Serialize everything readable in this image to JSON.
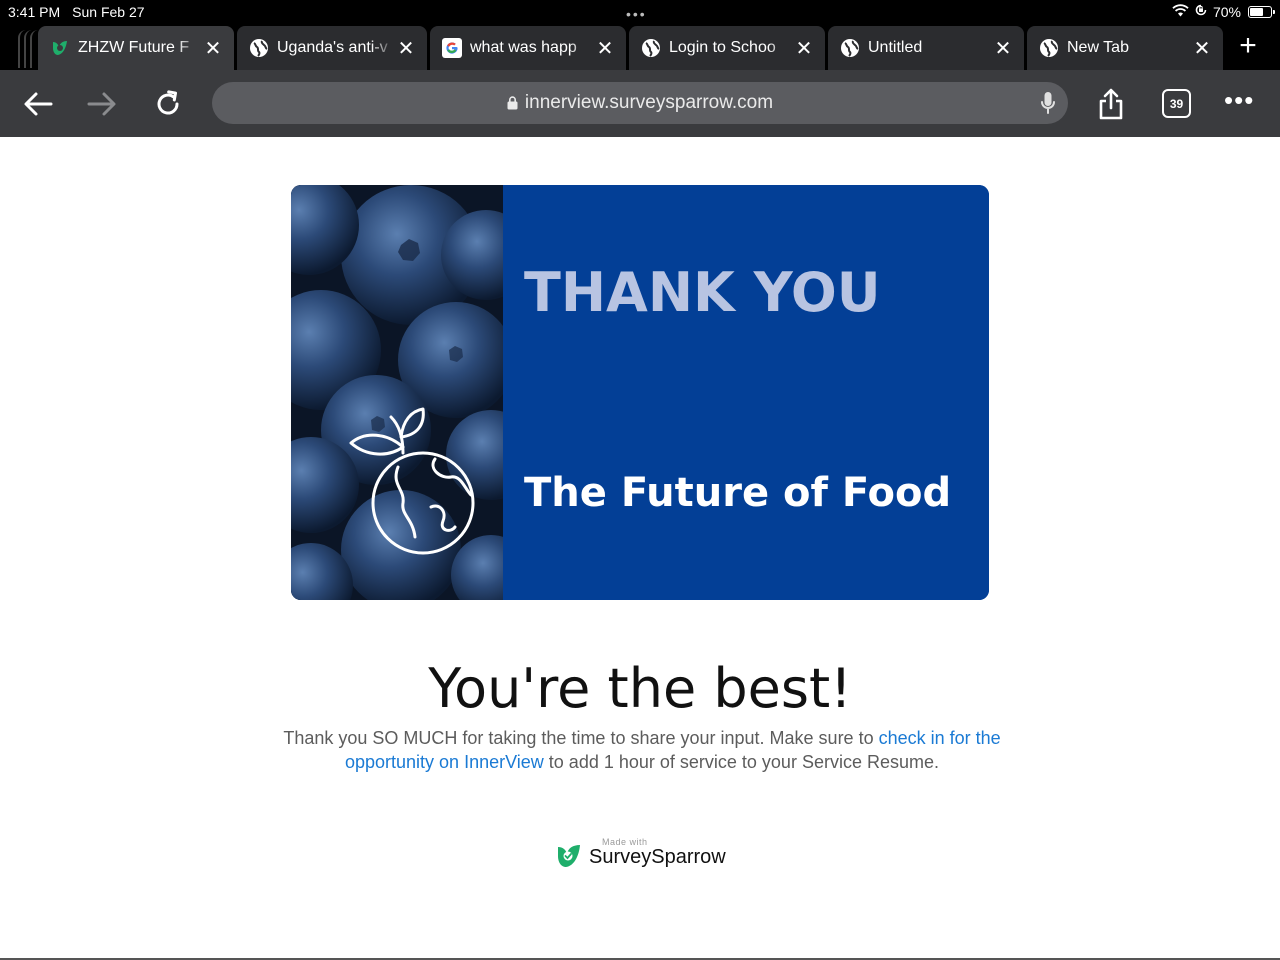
{
  "status_bar": {
    "time": "3:41 PM",
    "date": "Sun Feb 27",
    "battery_percent": "70%",
    "battery_level": 0.7,
    "icons": [
      "wifi-icon",
      "orientation-lock-icon",
      "battery-icon"
    ]
  },
  "tabs": [
    {
      "title": "ZHZW Future F",
      "favicon": "surveysparrow-icon",
      "active": true
    },
    {
      "title": "Uganda's anti-v",
      "favicon": "globe-icon",
      "active": false
    },
    {
      "title": "what was happ",
      "favicon": "google-icon",
      "active": false
    },
    {
      "title": "Login to Schoo",
      "favicon": "globe-icon",
      "active": false
    },
    {
      "title": "Untitled",
      "favicon": "globe-icon",
      "active": false
    },
    {
      "title": "New Tab",
      "favicon": "globe-icon",
      "active": false
    }
  ],
  "toolbar": {
    "url": "innerview.surveysparrow.com",
    "tab_count": "39"
  },
  "banner": {
    "heading": "THANK YOU",
    "subheading": "The Future of Food",
    "background_color": "#033f96"
  },
  "page": {
    "headline": "You're the best!",
    "body_part1": "Thank you SO MUCH for taking the time to share your input. Make sure to ",
    "body_link": "check in for the opportunity on InnerView",
    "body_part2": " to add 1 hour of service to your Service Resume.",
    "link_color": "#1a7ad4"
  },
  "footer": {
    "made_with": "Made with",
    "brand": "SurveySparrow",
    "brand_color": "#1fae6b"
  }
}
